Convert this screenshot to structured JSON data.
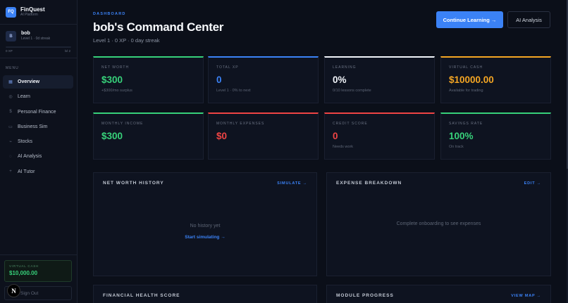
{
  "brand": {
    "logo": "FQ",
    "name": "FinQuest",
    "subtitle": "AI Platform"
  },
  "user": {
    "initial": "B",
    "name": "bob",
    "meta": "Level 1 · 0d streak",
    "xp_left": "0 XP",
    "xp_right": "lvl 2",
    "xp_progress": 0
  },
  "menu_label": "MENU",
  "nav": [
    {
      "label": "Overview",
      "icon": "grid-icon",
      "glyph": "▦",
      "active": true
    },
    {
      "label": "Learn",
      "icon": "learn-icon",
      "glyph": "◎",
      "active": false
    },
    {
      "label": "Personal Finance",
      "icon": "dollar-icon",
      "glyph": "$",
      "active": false
    },
    {
      "label": "Business Sim",
      "icon": "briefcase-icon",
      "glyph": "▭",
      "active": false
    },
    {
      "label": "Stocks",
      "icon": "stocks-icon",
      "glyph": "⌁",
      "active": false
    },
    {
      "label": "AI Analysis",
      "icon": "analysis-icon",
      "glyph": "◌",
      "active": false
    },
    {
      "label": "AI Tutor",
      "icon": "tutor-icon",
      "glyph": "+",
      "active": false
    }
  ],
  "virtual_cash": {
    "label": "VIRTUAL CASH",
    "value": "$10,000.00"
  },
  "signout": {
    "label": "Sign Out",
    "badge": "N"
  },
  "header": {
    "crumb": "DASHBOARD",
    "title": "bob's Command Center",
    "subtitle": "Level 1 · 0 XP · 0 day streak",
    "primary_button": "Continue Learning →",
    "secondary_button": "AI Analysis"
  },
  "stats": [
    {
      "label": "NET WORTH",
      "value": "$300",
      "note": "+$300/mo surplus",
      "color": "#37d17a"
    },
    {
      "label": "TOTAL XP",
      "value": "0",
      "note": "Level 1 · 0% to next",
      "color": "#3b82f6"
    },
    {
      "label": "LEARNING",
      "value": "0%",
      "note": "0/10 lessons complete",
      "color": "#f1f4f9"
    },
    {
      "label": "VIRTUAL CASH",
      "value": "$10000.00",
      "note": "Available for trading",
      "color": "#f5a623"
    },
    {
      "label": "MONTHLY INCOME",
      "value": "$300",
      "note": "",
      "color": "#37d17a"
    },
    {
      "label": "MONTHLY EXPENSES",
      "value": "$0",
      "note": "",
      "color": "#ef4444"
    },
    {
      "label": "CREDIT SCORE",
      "value": "0",
      "note": "Needs work",
      "color": "#ef4444"
    },
    {
      "label": "SAVINGS RATE",
      "value": "100%",
      "note": "On track",
      "color": "#37d17a"
    }
  ],
  "panels": {
    "net_worth": {
      "title": "NET WORTH HISTORY",
      "link": "SIMULATE →",
      "empty": "No history yet",
      "cta": "Start simulating →"
    },
    "expenses": {
      "title": "EXPENSE BREAKDOWN",
      "link": "EDIT →",
      "empty": "Complete onboarding to see expenses"
    },
    "health": {
      "title": "FINANCIAL HEALTH SCORE"
    },
    "modules": {
      "title": "MODULE PROGRESS",
      "link": "VIEW MAP →"
    }
  }
}
